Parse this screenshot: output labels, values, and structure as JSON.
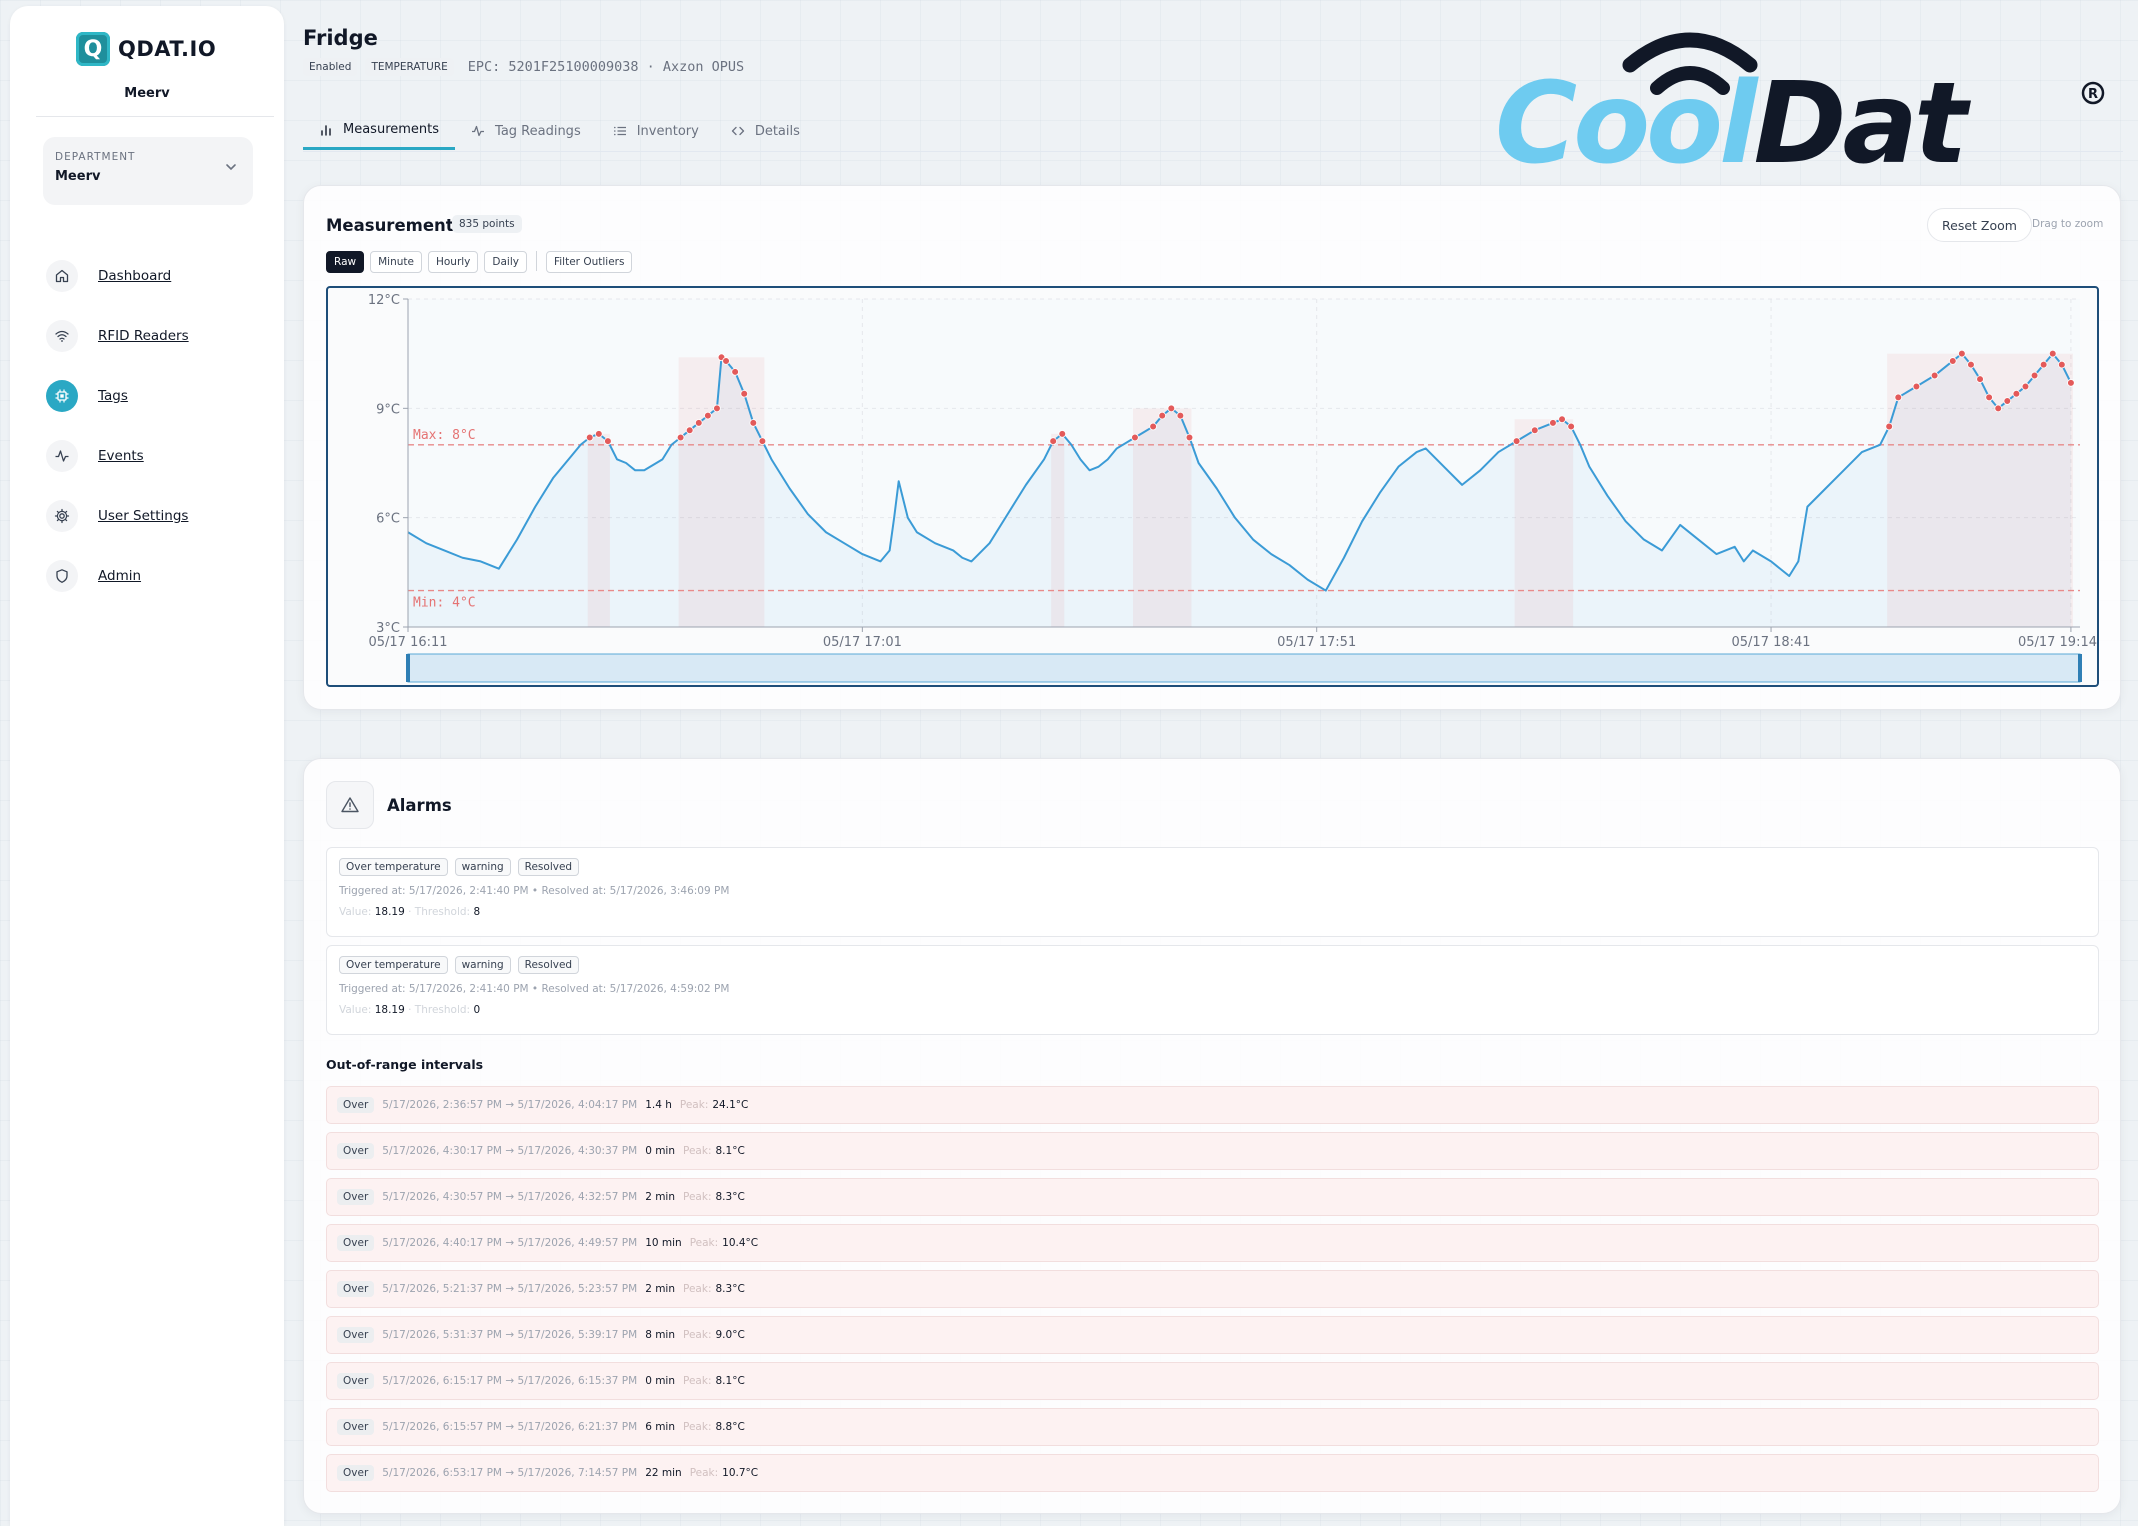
{
  "sidebar": {
    "brand": "QDAT.IO",
    "brand_logo_letter": "Q",
    "org": "Meerv",
    "department": {
      "label": "DEPARTMENT",
      "value": "Meerv"
    },
    "nav": [
      {
        "label": "Dashboard",
        "icon": "home-icon"
      },
      {
        "label": "RFID Readers",
        "icon": "wifi-icon"
      },
      {
        "label": "Tags",
        "icon": "chip-icon",
        "active": true
      },
      {
        "label": "Events",
        "icon": "activity-icon"
      },
      {
        "label": "User Settings",
        "icon": "gear-icon"
      },
      {
        "label": "Admin",
        "icon": "shield-icon"
      }
    ]
  },
  "header": {
    "title": "Fridge",
    "status": "Enabled",
    "type": "TEMPERATURE",
    "epc": "EPC: 5201F25100009038 · Axzon OPUS"
  },
  "tabs": [
    {
      "label": "Measurements",
      "icon": "bar-chart-icon",
      "active": true
    },
    {
      "label": "Tag Readings",
      "icon": "activity-icon"
    },
    {
      "label": "Inventory",
      "icon": "list-icon"
    },
    {
      "label": "Details",
      "icon": "code-icon"
    }
  ],
  "brand_mark": {
    "text_light": "Cool",
    "text_dark": "Dat",
    "reg": "R",
    "colors": {
      "light": "#6ecbf0",
      "dark": "#111827"
    }
  },
  "measurements": {
    "title": "Measurements",
    "points": "835 points",
    "resolutions": [
      "Raw",
      "Minute",
      "Hourly",
      "Daily"
    ],
    "active_resolution": "Raw",
    "filter": "Filter Outliers",
    "reset_zoom": "Reset Zoom",
    "drag_hint": "Drag to zoom"
  },
  "chart_data": {
    "type": "line",
    "x_unit": "minutes since 05/17 16:11",
    "xticks": [
      "05/17 16:11",
      "05/17 17:01",
      "05/17 17:51",
      "05/17 18:41",
      "05/17 19:14"
    ],
    "xtick_positions_min": [
      0,
      50,
      100,
      150,
      183
    ],
    "yticks": [
      "3°C",
      "6°C",
      "9°C",
      "12°C"
    ],
    "ylim": [
      3,
      12
    ],
    "xlim": [
      0,
      184
    ],
    "thresholds": {
      "max": 8,
      "min": 4,
      "max_label": "Max: 8°C",
      "min_label": "Min: 4°C"
    },
    "colors": {
      "line": "#3b9bd6",
      "over": "#e35a5a",
      "threshold": "#e88a8a"
    },
    "series": [
      {
        "values": [
          [
            0,
            5.6
          ],
          [
            2,
            5.3
          ],
          [
            4,
            5.1
          ],
          [
            6,
            4.9
          ],
          [
            8,
            4.8
          ],
          [
            10,
            4.6
          ],
          [
            12,
            5.4
          ],
          [
            14,
            6.3
          ],
          [
            16,
            7.1
          ],
          [
            18,
            7.7
          ],
          [
            19,
            8.0
          ],
          [
            20,
            8.2
          ],
          [
            21,
            8.3
          ],
          [
            22,
            8.1
          ],
          [
            23,
            7.6
          ],
          [
            24,
            7.5
          ],
          [
            25,
            7.3
          ],
          [
            26,
            7.3
          ],
          [
            28,
            7.6
          ],
          [
            29,
            8.0
          ],
          [
            30,
            8.2
          ],
          [
            31,
            8.4
          ],
          [
            32,
            8.6
          ],
          [
            33,
            8.8
          ],
          [
            34,
            9.0
          ],
          [
            34.5,
            10.4
          ],
          [
            35,
            10.3
          ],
          [
            36,
            10.0
          ],
          [
            37,
            9.4
          ],
          [
            38,
            8.6
          ],
          [
            39,
            8.1
          ],
          [
            40,
            7.6
          ],
          [
            42,
            6.8
          ],
          [
            44,
            6.1
          ],
          [
            46,
            5.6
          ],
          [
            48,
            5.3
          ],
          [
            50,
            5.0
          ],
          [
            52,
            4.8
          ],
          [
            53,
            5.1
          ],
          [
            53.5,
            6.0
          ],
          [
            54,
            7.0
          ],
          [
            55,
            6.0
          ],
          [
            56,
            5.6
          ],
          [
            58,
            5.3
          ],
          [
            60,
            5.1
          ],
          [
            61,
            4.9
          ],
          [
            62,
            4.8
          ],
          [
            64,
            5.3
          ],
          [
            66,
            6.1
          ],
          [
            68,
            6.9
          ],
          [
            70,
            7.6
          ],
          [
            71,
            8.1
          ],
          [
            72,
            8.3
          ],
          [
            73,
            8.0
          ],
          [
            74,
            7.6
          ],
          [
            75,
            7.3
          ],
          [
            76,
            7.4
          ],
          [
            77,
            7.6
          ],
          [
            78,
            7.9
          ],
          [
            80,
            8.2
          ],
          [
            82,
            8.5
          ],
          [
            83,
            8.8
          ],
          [
            84,
            9.0
          ],
          [
            85,
            8.8
          ],
          [
            86,
            8.2
          ],
          [
            87,
            7.5
          ],
          [
            89,
            6.8
          ],
          [
            91,
            6.0
          ],
          [
            93,
            5.4
          ],
          [
            95,
            5.0
          ],
          [
            97,
            4.7
          ],
          [
            99,
            4.3
          ],
          [
            101,
            4.0
          ],
          [
            103,
            4.9
          ],
          [
            105,
            5.9
          ],
          [
            107,
            6.7
          ],
          [
            109,
            7.4
          ],
          [
            111,
            7.8
          ],
          [
            112,
            7.9
          ],
          [
            114,
            7.4
          ],
          [
            116,
            6.9
          ],
          [
            118,
            7.3
          ],
          [
            120,
            7.8
          ],
          [
            122,
            8.1
          ],
          [
            124,
            8.4
          ],
          [
            126,
            8.6
          ],
          [
            127,
            8.7
          ],
          [
            128,
            8.5
          ],
          [
            129,
            8.0
          ],
          [
            130,
            7.4
          ],
          [
            132,
            6.6
          ],
          [
            134,
            5.9
          ],
          [
            136,
            5.4
          ],
          [
            138,
            5.1
          ],
          [
            140,
            5.8
          ],
          [
            142,
            5.4
          ],
          [
            144,
            5.0
          ],
          [
            146,
            5.2
          ],
          [
            147,
            4.8
          ],
          [
            148,
            5.1
          ],
          [
            150,
            4.8
          ],
          [
            152,
            4.4
          ],
          [
            153,
            4.8
          ],
          [
            154,
            6.3
          ],
          [
            156,
            6.8
          ],
          [
            158,
            7.3
          ],
          [
            160,
            7.8
          ],
          [
            162,
            8.0
          ],
          [
            163,
            8.5
          ],
          [
            164,
            9.3
          ],
          [
            166,
            9.6
          ],
          [
            168,
            9.9
          ],
          [
            170,
            10.3
          ],
          [
            171,
            10.5
          ],
          [
            172,
            10.2
          ],
          [
            173,
            9.8
          ],
          [
            174,
            9.3
          ],
          [
            175,
            9.0
          ],
          [
            176,
            9.2
          ],
          [
            177,
            9.4
          ],
          [
            178,
            9.6
          ],
          [
            179,
            9.9
          ],
          [
            180,
            10.2
          ],
          [
            181,
            10.5
          ],
          [
            182,
            10.2
          ],
          [
            183,
            9.7
          ]
        ]
      }
    ]
  },
  "alarms": {
    "title": "Alarms",
    "items": [
      {
        "kind": "Over temperature",
        "severity": "warning",
        "status": "Resolved",
        "triggered": "Triggered at: 5/17/2026, 2:41:40 PM • Resolved at: 5/17/2026, 3:46:09 PM",
        "value_label": "Value:",
        "value": "18.19",
        "threshold_label": "· Threshold:",
        "threshold": "8"
      },
      {
        "kind": "Over temperature",
        "severity": "warning",
        "status": "Resolved",
        "triggered": "Triggered at: 5/17/2026, 2:41:40 PM • Resolved at: 5/17/2026, 4:59:02 PM",
        "value_label": "Value:",
        "value": "18.19",
        "threshold_label": "· Threshold:",
        "threshold": "0"
      }
    ]
  },
  "out_of_range": {
    "title": "Out-of-range intervals",
    "peak_label": "Peak:",
    "rows": [
      {
        "kind": "Over",
        "range": "5/17/2026, 2:36:57 PM → 5/17/2026, 4:04:17 PM",
        "duration": "1.4 h",
        "peak": "24.1°C"
      },
      {
        "kind": "Over",
        "range": "5/17/2026, 4:30:17 PM → 5/17/2026, 4:30:37 PM",
        "duration": "0 min",
        "peak": "8.1°C"
      },
      {
        "kind": "Over",
        "range": "5/17/2026, 4:30:57 PM → 5/17/2026, 4:32:57 PM",
        "duration": "2 min",
        "peak": "8.3°C"
      },
      {
        "kind": "Over",
        "range": "5/17/2026, 4:40:17 PM → 5/17/2026, 4:49:57 PM",
        "duration": "10 min",
        "peak": "10.4°C"
      },
      {
        "kind": "Over",
        "range": "5/17/2026, 5:21:37 PM → 5/17/2026, 5:23:57 PM",
        "duration": "2 min",
        "peak": "8.3°C"
      },
      {
        "kind": "Over",
        "range": "5/17/2026, 5:31:37 PM → 5/17/2026, 5:39:17 PM",
        "duration": "8 min",
        "peak": "9.0°C"
      },
      {
        "kind": "Over",
        "range": "5/17/2026, 6:15:17 PM → 5/17/2026, 6:15:37 PM",
        "duration": "0 min",
        "peak": "8.1°C"
      },
      {
        "kind": "Over",
        "range": "5/17/2026, 6:15:57 PM → 5/17/2026, 6:21:37 PM",
        "duration": "6 min",
        "peak": "8.8°C"
      },
      {
        "kind": "Over",
        "range": "5/17/2026, 6:53:17 PM → 5/17/2026, 7:14:57 PM",
        "duration": "22 min",
        "peak": "10.7°C"
      }
    ]
  }
}
